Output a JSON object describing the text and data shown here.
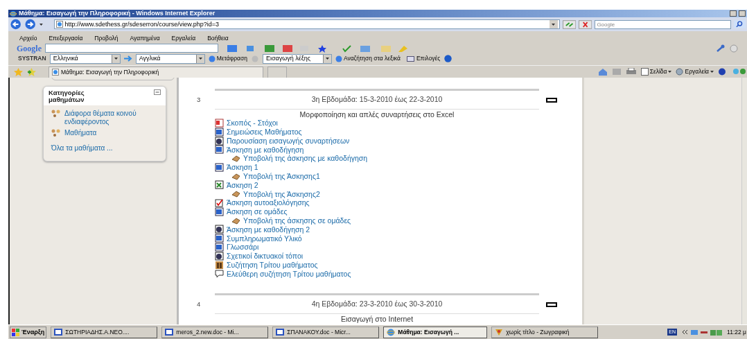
{
  "window": {
    "title": "Μάθημα: Εισαγωγή την Πληροφορική - Windows Internet Explorer"
  },
  "address": {
    "url": "http://www.sdethess.gr/sdeserron/course/view.php?id=3"
  },
  "search": {
    "placeholder": "Google"
  },
  "menu": [
    "Αρχείο",
    "Επεξεργασία",
    "Προβολή",
    "Αγαπημένα",
    "Εργαλεία",
    "Βοήθεια"
  ],
  "google_toolbar": {
    "label": "Google"
  },
  "systran": {
    "label": "SYSTRAN",
    "from": "Ελληνικά",
    "to": "Αγγλικά",
    "translate": "Μετάφραση",
    "word": "Εισαγωγή λέξης",
    "dictionary": "Αναζήτηση στα λεξικά",
    "options": "Επιλογές"
  },
  "tab": {
    "label": "Μάθημα: Εισαγωγή την Πληροφορική"
  },
  "command_bar": [
    "Σελίδα",
    "Εργαλεία"
  ],
  "sidebar": {
    "title": "Κατηγορίες μαθημάτων",
    "items": [
      {
        "label": "Διάφορα θέματα κοινού ενδιαφέροντος",
        "kind": "category"
      },
      {
        "label": "Μαθήματα",
        "kind": "category"
      },
      {
        "label": "Όλα τα μαθήματα ...",
        "kind": "link"
      }
    ]
  },
  "sections": [
    {
      "number": "3",
      "title": "3η Εβδομάδα: 15-3-2010 έως 22-3-2010",
      "summary": "Μορφοποίηση και απλές συναρτήσεις στο Excel",
      "items": [
        {
          "label": "Σκοπός - Στόχοι",
          "kind": "pdf"
        },
        {
          "label": "Σημειώσεις Μαθήματος",
          "kind": "doc"
        },
        {
          "label": "Παρουσίαση εισαγωγής συναρτήσεων",
          "kind": "web"
        },
        {
          "label": "Άσκηση με καθοδήγηση",
          "kind": "doc",
          "children": [
            {
              "label": "Υποβολή της άσκησης με καθοδήγηση",
              "kind": "upload"
            }
          ]
        },
        {
          "label": "Άσκηση 1",
          "kind": "doc",
          "children": [
            {
              "label": "Υποβολή της Άσκησης1",
              "kind": "upload"
            }
          ]
        },
        {
          "label": "Άσκηση 2",
          "kind": "excel",
          "children": [
            {
              "label": "Υποβολή της Άσκησης2",
              "kind": "upload"
            }
          ]
        },
        {
          "label": "Άσκηση αυτοαξιολόγησης",
          "kind": "quiz"
        },
        {
          "label": "Άσκηση σε ομάδες",
          "kind": "doc",
          "children": [
            {
              "label": "Υποβολή της άσκησης σε ομάδες",
              "kind": "upload"
            }
          ]
        },
        {
          "label": "Άσκηση με καθοδήγηση 2",
          "kind": "web"
        },
        {
          "label": "Συμπληρωματικό Υλικό",
          "kind": "doc"
        },
        {
          "label": "Γλωσσάρι",
          "kind": "doc"
        },
        {
          "label": "Σχετικοί δικτυακοί τόποι",
          "kind": "web"
        },
        {
          "label": "Συζήτηση Τρίτου μαθήματος",
          "kind": "forum"
        },
        {
          "label": "Ελεύθερη συζήτηση Τρίτου μαθήματος",
          "kind": "chat"
        }
      ]
    },
    {
      "number": "4",
      "title": "4η Εβδομάδα: 23-3-2010 έως 30-3-2010",
      "summary": "Εισαγωγή στο Internet"
    }
  ],
  "taskbar": {
    "start": "Έναρξη",
    "items": [
      {
        "label": "ΣΩΤΗΡΙΑΔΗΣ.Α.ΝΕΟ....",
        "kind": "word",
        "selected": false
      },
      {
        "label": "meros_2.new.doc - Mi...",
        "kind": "word",
        "selected": false
      },
      {
        "label": "ΣΠΑΝΑΚΟΥ.doc - Micr...",
        "kind": "word",
        "selected": false
      },
      {
        "label": "Μάθημα: Εισαγωγή ...",
        "kind": "ie",
        "selected": true
      },
      {
        "label": "χωρίς τίτλο - Ζωγραφική",
        "kind": "paint",
        "selected": false
      }
    ],
    "language": "EN",
    "clock": "11:22 μ"
  }
}
